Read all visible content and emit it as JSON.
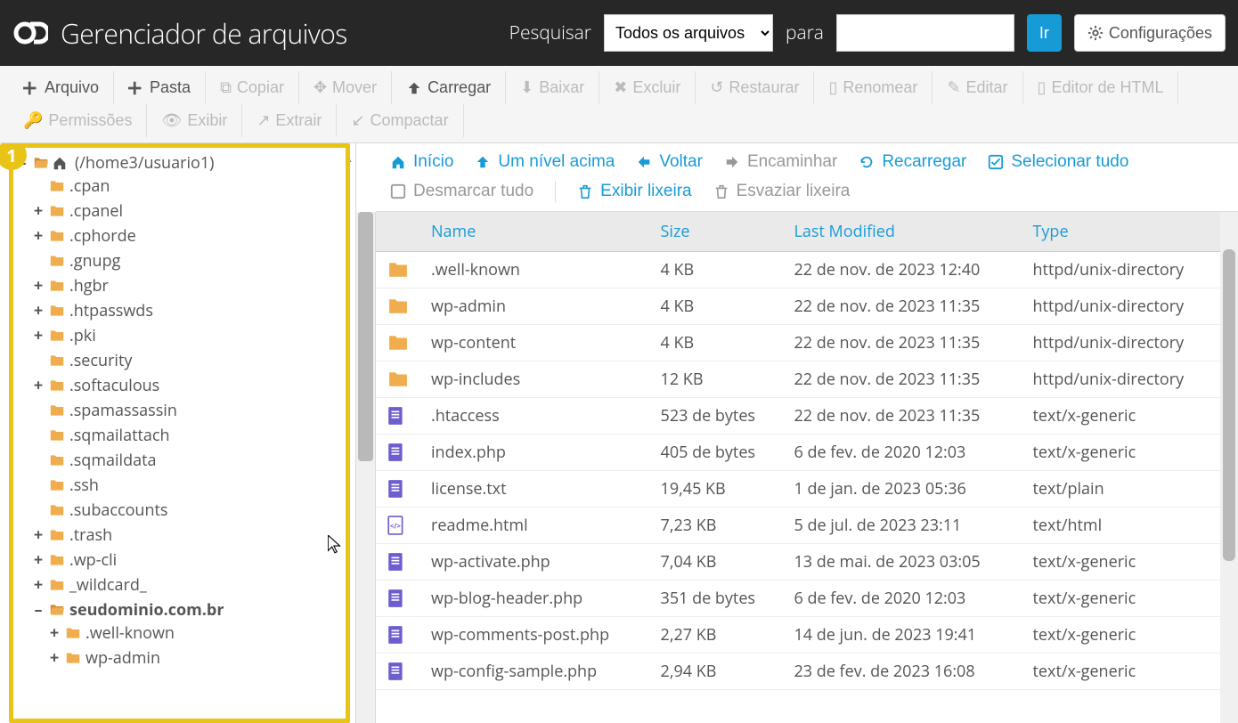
{
  "header": {
    "title": "Gerenciador de arquivos",
    "search_label": "Pesquisar",
    "for_label": "para",
    "search_select": "Todos os arquivos",
    "go_label": "Ir",
    "settings_label": "Configurações"
  },
  "toolbar": {
    "file_label": "Arquivo",
    "folder_label": "Pasta",
    "copy_label": "Copiar",
    "move_label": "Mover",
    "upload_label": "Carregar",
    "download_label": "Baixar",
    "delete_label": "Excluir",
    "restore_label": "Restaurar",
    "rename_label": "Renomear",
    "edit_label": "Editar",
    "html_editor_label": "Editor de HTML",
    "permissions_label": "Permissões",
    "view_label": "Exibir",
    "extract_label": "Extrair",
    "compress_label": "Compactar"
  },
  "actionbar": {
    "home_label": "Início",
    "up_label": "Um nível acima",
    "back_label": "Voltar",
    "forward_label": "Encaminhar",
    "reload_label": "Recarregar",
    "select_all_label": "Selecionar tudo",
    "deselect_all_label": "Desmarcar tudo",
    "show_trash_label": "Exibir lixeira",
    "empty_trash_label": "Esvaziar lixeira"
  },
  "tree": {
    "root_label": "(/home3/usuario1)",
    "items": [
      {
        "label": ".cpan",
        "toggle": ""
      },
      {
        "label": ".cpanel",
        "toggle": "+"
      },
      {
        "label": ".cphorde",
        "toggle": "+"
      },
      {
        "label": ".gnupg",
        "toggle": ""
      },
      {
        "label": ".hgbr",
        "toggle": "+"
      },
      {
        "label": ".htpasswds",
        "toggle": "+"
      },
      {
        "label": ".pki",
        "toggle": "+"
      },
      {
        "label": ".security",
        "toggle": ""
      },
      {
        "label": ".softaculous",
        "toggle": "+"
      },
      {
        "label": ".spamassassin",
        "toggle": ""
      },
      {
        "label": ".sqmailattach",
        "toggle": ""
      },
      {
        "label": ".sqmaildata",
        "toggle": ""
      },
      {
        "label": ".ssh",
        "toggle": ""
      },
      {
        "label": ".subaccounts",
        "toggle": ""
      },
      {
        "label": ".trash",
        "toggle": "+"
      },
      {
        "label": ".wp-cli",
        "toggle": "+"
      },
      {
        "label": "_wildcard_",
        "toggle": "+"
      }
    ],
    "selected": {
      "label": "seudominio.com.br",
      "toggle": "–",
      "children": [
        {
          "label": ".well-known",
          "toggle": "+"
        },
        {
          "label": "wp-admin",
          "toggle": "+"
        }
      ]
    }
  },
  "badge_number": "1",
  "table": {
    "headers": {
      "name": "Name",
      "size": "Size",
      "modified": "Last Modified",
      "type": "Type"
    },
    "rows": [
      {
        "icon": "folder",
        "name": ".well-known",
        "size": "4 KB",
        "modified": "22 de nov. de 2023 12:40",
        "type": "httpd/unix-directory"
      },
      {
        "icon": "folder",
        "name": "wp-admin",
        "size": "4 KB",
        "modified": "22 de nov. de 2023 11:35",
        "type": "httpd/unix-directory"
      },
      {
        "icon": "folder",
        "name": "wp-content",
        "size": "4 KB",
        "modified": "22 de nov. de 2023 11:35",
        "type": "httpd/unix-directory"
      },
      {
        "icon": "folder",
        "name": "wp-includes",
        "size": "12 KB",
        "modified": "22 de nov. de 2023 11:35",
        "type": "httpd/unix-directory"
      },
      {
        "icon": "file",
        "name": ".htaccess",
        "size": "523 de bytes",
        "modified": "22 de nov. de 2023 11:35",
        "type": "text/x-generic"
      },
      {
        "icon": "file",
        "name": "index.php",
        "size": "405 de bytes",
        "modified": "6 de fev. de 2020 12:03",
        "type": "text/x-generic"
      },
      {
        "icon": "file",
        "name": "license.txt",
        "size": "19,45 KB",
        "modified": "1 de jan. de 2023 05:36",
        "type": "text/plain"
      },
      {
        "icon": "html",
        "name": "readme.html",
        "size": "7,23 KB",
        "modified": "5 de jul. de 2023 23:11",
        "type": "text/html"
      },
      {
        "icon": "file",
        "name": "wp-activate.php",
        "size": "7,04 KB",
        "modified": "13 de mai. de 2023 03:05",
        "type": "text/x-generic"
      },
      {
        "icon": "file",
        "name": "wp-blog-header.php",
        "size": "351 de bytes",
        "modified": "6 de fev. de 2020 12:03",
        "type": "text/x-generic"
      },
      {
        "icon": "file",
        "name": "wp-comments-post.php",
        "size": "2,27 KB",
        "modified": "14 de jun. de 2023 19:41",
        "type": "text/x-generic"
      },
      {
        "icon": "file",
        "name": "wp-config-sample.php",
        "size": "2,94 KB",
        "modified": "23 de fev. de 2023 16:08",
        "type": "text/x-generic"
      }
    ]
  }
}
